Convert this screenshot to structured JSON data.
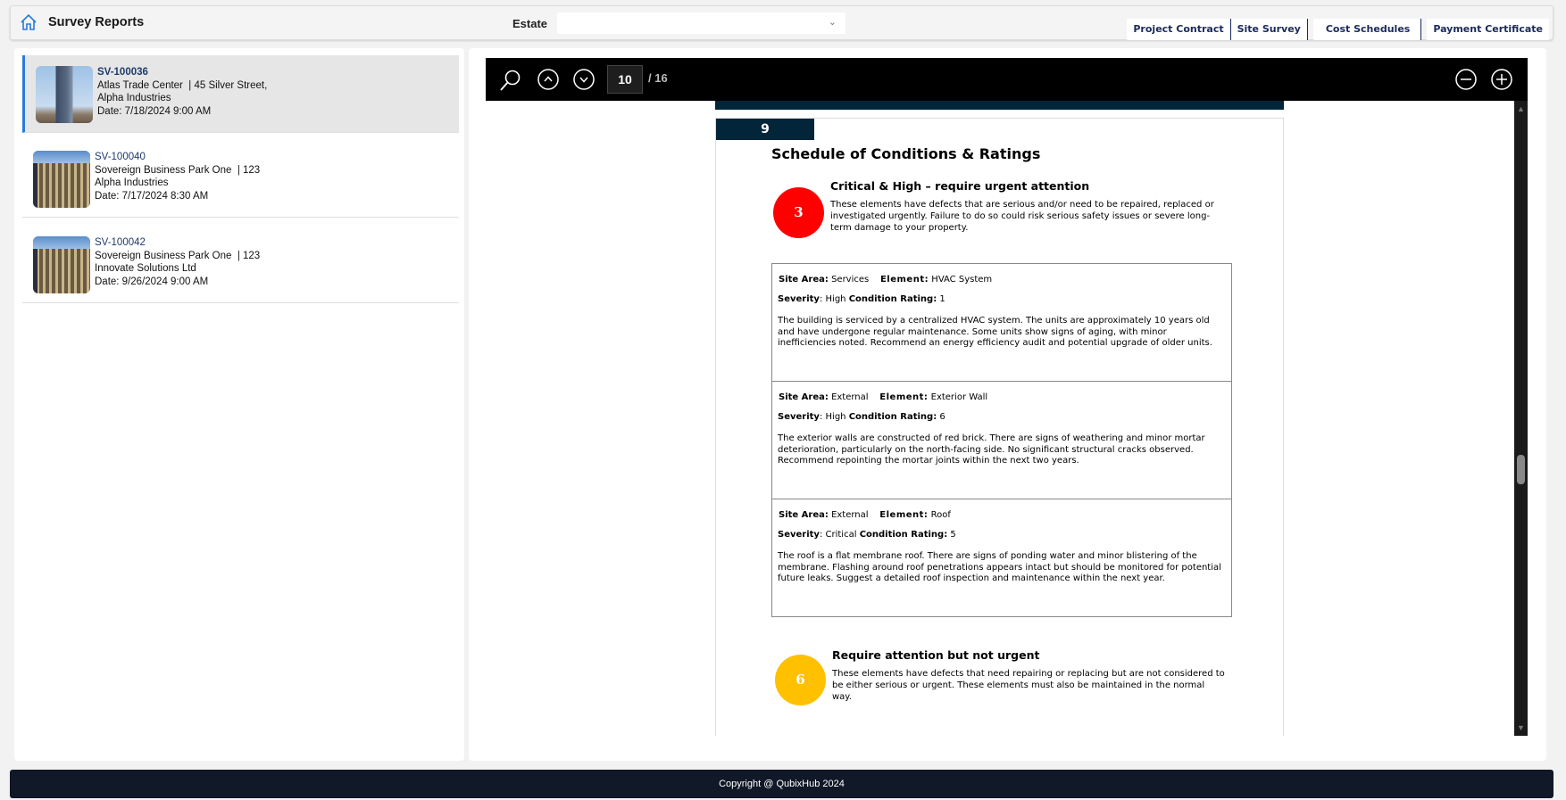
{
  "header": {
    "title": "Survey Reports",
    "estate_label": "Estate",
    "estate_value": "",
    "tabs": [
      "Project Contract",
      "Site Survey",
      "Cost Schedules",
      "Payment Certificate"
    ]
  },
  "surveys": [
    {
      "code": "SV-100036",
      "site": "Atlas Trade Center",
      "address": "| 45 Silver Street,",
      "company": "Alpha Industries",
      "date": "Date: 7/18/2024 9:00 AM"
    },
    {
      "code": "SV-100040",
      "site": "Sovereign Business Park One",
      "address": "| 123",
      "company": "Alpha Industries",
      "date": "Date: 7/17/2024 8:30 AM"
    },
    {
      "code": "SV-100042",
      "site": "Sovereign Business Park One",
      "address": "| 123",
      "company": "Innovate Solutions Ltd",
      "date": "Date: 9/26/2024 9:00 AM"
    }
  ],
  "viewer": {
    "current_page": "10",
    "total_pages": "/ 16"
  },
  "document": {
    "page_number": "9",
    "title": "Schedule of Conditions & Ratings",
    "urgent": {
      "count": "3",
      "color": "#ff0000",
      "heading": "Critical & High – require urgent attention",
      "description": "These elements have defects that are serious and/or need to be repaired, replaced or investigated urgently. Failure to do so could risk serious safety issues or severe long-term damage to your property."
    },
    "labels": {
      "site_area": "Site Area:",
      "element": "Element:",
      "severity": "Severity",
      "condition_rating": "Condition Rating:"
    },
    "items": [
      {
        "site_area": "Services",
        "element": "HVAC System",
        "severity": "High",
        "rating": "1",
        "description": "The building is serviced by a centralized HVAC system. The units are approximately 10 years old and have undergone regular maintenance. Some units show signs of aging, with minor inefficiencies noted. Recommend an energy efficiency audit and potential upgrade of older units."
      },
      {
        "site_area": "External",
        "element": "Exterior Wall",
        "severity": "High",
        "rating": "6",
        "description": "The exterior walls are constructed of red brick. There are signs of weathering and minor mortar deterioration, particularly on the north-facing side. No significant structural cracks observed. Recommend repointing the mortar joints within the next two years."
      },
      {
        "site_area": "External",
        "element": "Roof",
        "severity": "Critical",
        "rating": "5",
        "description": "The roof is a flat membrane roof. There are signs of ponding water and minor blistering of the membrane. Flashing around roof penetrations appears intact but should be monitored for potential future leaks. Suggest a detailed roof inspection and maintenance within the next year."
      }
    ],
    "not_urgent": {
      "count": "6",
      "color": "#ffc000",
      "heading": "Require attention but not urgent",
      "description": "These elements have defects that need repairing or replacing but are not considered to be either serious or urgent. These elements must also be maintained in the normal way."
    }
  },
  "footer": {
    "copyright": "Copyright @ QubixHub 2024"
  }
}
